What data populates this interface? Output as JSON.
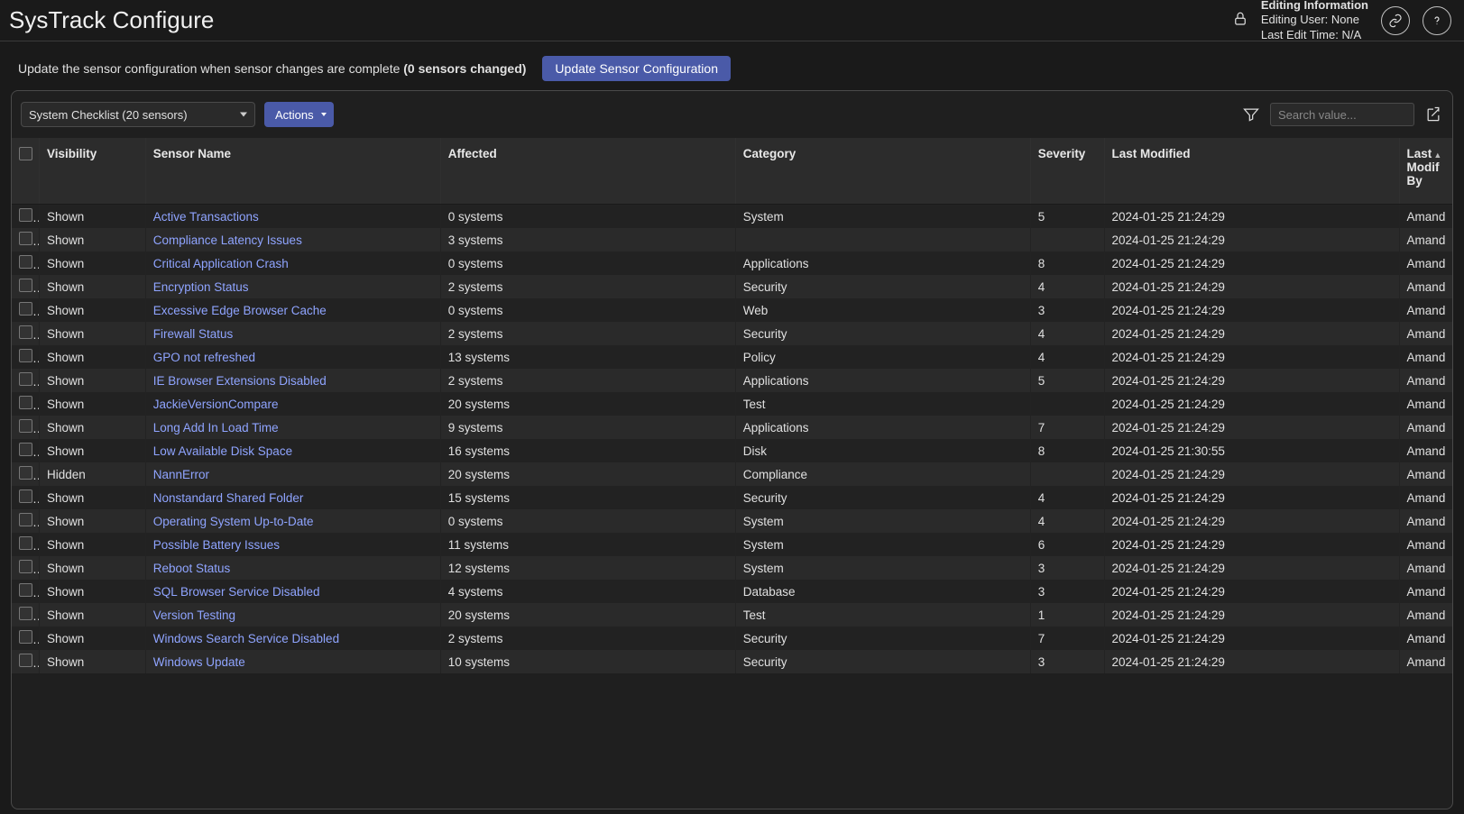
{
  "header": {
    "title": "SysTrack Configure",
    "edit_info_title": "Editing Information",
    "edit_user_label": "Editing User:",
    "edit_user_value": "None",
    "last_edit_label": "Last Edit Time:",
    "last_edit_value": "N/A"
  },
  "subbar": {
    "msg_pre": "Update the sensor configuration when sensor changes are complete ",
    "msg_bold": "(0 sensors changed)",
    "update_btn": "Update Sensor Configuration"
  },
  "toolbar": {
    "select_label": "System Checklist (20 sensors)",
    "actions_label": "Actions",
    "search_placeholder": "Search value..."
  },
  "table": {
    "headers": {
      "visibility": "Visibility",
      "sensor_name": "Sensor Name",
      "affected": "Affected",
      "category": "Category",
      "severity": "Severity",
      "last_modified": "Last Modified",
      "last_modified_by": "Last Modified By"
    },
    "rows": [
      {
        "vis": "Shown",
        "name": "Active Transactions",
        "aff": "0 systems",
        "cat": "System",
        "sev": "5",
        "mod": "2024-01-25 21:24:29",
        "by": "Amand"
      },
      {
        "vis": "Shown",
        "name": "Compliance Latency Issues",
        "aff": "3 systems",
        "cat": "",
        "sev": "",
        "mod": "2024-01-25 21:24:29",
        "by": "Amand"
      },
      {
        "vis": "Shown",
        "name": "Critical Application Crash",
        "aff": "0 systems",
        "cat": "Applications",
        "sev": "8",
        "mod": "2024-01-25 21:24:29",
        "by": "Amand"
      },
      {
        "vis": "Shown",
        "name": "Encryption Status",
        "aff": "2 systems",
        "cat": "Security",
        "sev": "4",
        "mod": "2024-01-25 21:24:29",
        "by": "Amand"
      },
      {
        "vis": "Shown",
        "name": "Excessive Edge Browser Cache",
        "aff": "0 systems",
        "cat": "Web",
        "sev": "3",
        "mod": "2024-01-25 21:24:29",
        "by": "Amand"
      },
      {
        "vis": "Shown",
        "name": "Firewall Status",
        "aff": "2 systems",
        "cat": "Security",
        "sev": "4",
        "mod": "2024-01-25 21:24:29",
        "by": "Amand"
      },
      {
        "vis": "Shown",
        "name": "GPO not refreshed",
        "aff": "13 systems",
        "cat": "Policy",
        "sev": "4",
        "mod": "2024-01-25 21:24:29",
        "by": "Amand"
      },
      {
        "vis": "Shown",
        "name": "IE Browser Extensions Disabled",
        "aff": "2 systems",
        "cat": "Applications",
        "sev": "5",
        "mod": "2024-01-25 21:24:29",
        "by": "Amand"
      },
      {
        "vis": "Shown",
        "name": "JackieVersionCompare",
        "aff": "20 systems",
        "cat": "Test",
        "sev": "",
        "mod": "2024-01-25 21:24:29",
        "by": "Amand"
      },
      {
        "vis": "Shown",
        "name": "Long Add In Load Time",
        "aff": "9 systems",
        "cat": "Applications",
        "sev": "7",
        "mod": "2024-01-25 21:24:29",
        "by": "Amand"
      },
      {
        "vis": "Shown",
        "name": "Low Available Disk Space",
        "aff": "16 systems",
        "cat": "Disk",
        "sev": "8",
        "mod": "2024-01-25 21:30:55",
        "by": "Amand"
      },
      {
        "vis": "Hidden",
        "name": "NannError",
        "aff": "20 systems",
        "cat": "Compliance",
        "sev": "",
        "mod": "2024-01-25 21:24:29",
        "by": "Amand"
      },
      {
        "vis": "Shown",
        "name": "Nonstandard Shared Folder",
        "aff": "15 systems",
        "cat": "Security",
        "sev": "4",
        "mod": "2024-01-25 21:24:29",
        "by": "Amand"
      },
      {
        "vis": "Shown",
        "name": "Operating System Up-to-Date",
        "aff": "0 systems",
        "cat": "System",
        "sev": "4",
        "mod": "2024-01-25 21:24:29",
        "by": "Amand"
      },
      {
        "vis": "Shown",
        "name": "Possible Battery Issues",
        "aff": "11 systems",
        "cat": "System",
        "sev": "6",
        "mod": "2024-01-25 21:24:29",
        "by": "Amand"
      },
      {
        "vis": "Shown",
        "name": "Reboot Status",
        "aff": "12 systems",
        "cat": "System",
        "sev": "3",
        "mod": "2024-01-25 21:24:29",
        "by": "Amand"
      },
      {
        "vis": "Shown",
        "name": "SQL Browser Service Disabled",
        "aff": "4 systems",
        "cat": "Database",
        "sev": "3",
        "mod": "2024-01-25 21:24:29",
        "by": "Amand"
      },
      {
        "vis": "Shown",
        "name": "Version Testing",
        "aff": "20 systems",
        "cat": "Test",
        "sev": "1",
        "mod": "2024-01-25 21:24:29",
        "by": "Amand"
      },
      {
        "vis": "Shown",
        "name": "Windows Search Service Disabled",
        "aff": "2 systems",
        "cat": "Security",
        "sev": "7",
        "mod": "2024-01-25 21:24:29",
        "by": "Amand"
      },
      {
        "vis": "Shown",
        "name": "Windows Update",
        "aff": "10 systems",
        "cat": "Security",
        "sev": "3",
        "mod": "2024-01-25 21:24:29",
        "by": "Amand"
      }
    ]
  }
}
